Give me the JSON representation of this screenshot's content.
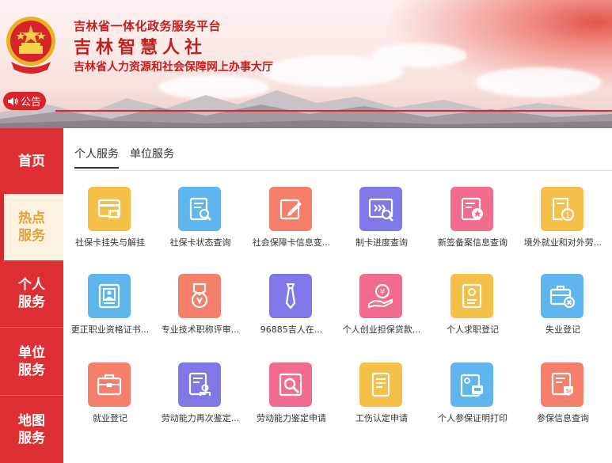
{
  "header": {
    "platform": "吉林省一体化政务服务平台",
    "brand": "吉林智慧人社",
    "subtitle": "吉林省人力资源和社会保障网上办事大厅",
    "notice_label": "公告"
  },
  "sidenav": {
    "items": [
      {
        "line1": "首页",
        "line2": ""
      },
      {
        "line1": "热点",
        "line2": "服务"
      },
      {
        "line1": "个人",
        "line2": "服务"
      },
      {
        "line1": "单位",
        "line2": "服务"
      },
      {
        "line1": "地图",
        "line2": "服务"
      }
    ]
  },
  "tabs": [
    "个人服务",
    "单位服务"
  ],
  "services": [
    {
      "label": "社保卡挂失与解挂",
      "icon": "card-lock-icon",
      "color": "#f5c04a"
    },
    {
      "label": "社保卡状态查询",
      "icon": "doc-search-icon",
      "color": "#5fb6ee"
    },
    {
      "label": "社会保障卡信息变...",
      "icon": "edit-icon",
      "color": "#f47f6b"
    },
    {
      "label": "制卡进度查询",
      "icon": "card-search-icon",
      "color": "#7f78e6"
    },
    {
      "label": "新签备案信息查询",
      "icon": "doc-star-icon",
      "color": "#f26d8d"
    },
    {
      "label": "境外就业和对外劳...",
      "icon": "doc-coin-icon",
      "color": "#f5c04a"
    },
    {
      "label": "更正职业资格证书...",
      "icon": "certificate-icon",
      "color": "#5fb6ee"
    },
    {
      "label": "专业技术职称评审...",
      "icon": "medal-icon",
      "color": "#f47f6b"
    },
    {
      "label": "96885吉人在...",
      "icon": "tie-icon",
      "color": "#7f78e6"
    },
    {
      "label": "个人创业担保贷款...",
      "icon": "loan-hand-icon",
      "color": "#f26d8d"
    },
    {
      "label": "个人求职登记",
      "icon": "resume-icon",
      "color": "#f5c04a"
    },
    {
      "label": "失业登记",
      "icon": "briefcase-x-icon",
      "color": "#5fb6ee"
    },
    {
      "label": "就业登记",
      "icon": "briefcase-icon",
      "color": "#f47f6b"
    },
    {
      "label": "劳动能力再次鉴定...",
      "icon": "doc-person-icon",
      "color": "#7f78e6"
    },
    {
      "label": "劳动能力鉴定申请",
      "icon": "search-frame-icon",
      "color": "#f26d8d"
    },
    {
      "label": "工伤认定申请",
      "icon": "document-icon",
      "color": "#f5c04a"
    },
    {
      "label": "个人参保证明打印",
      "icon": "print-card-icon",
      "color": "#5fb6ee"
    },
    {
      "label": "参保信息查询",
      "icon": "doc-si-icon",
      "color": "#f47f6b"
    }
  ]
}
